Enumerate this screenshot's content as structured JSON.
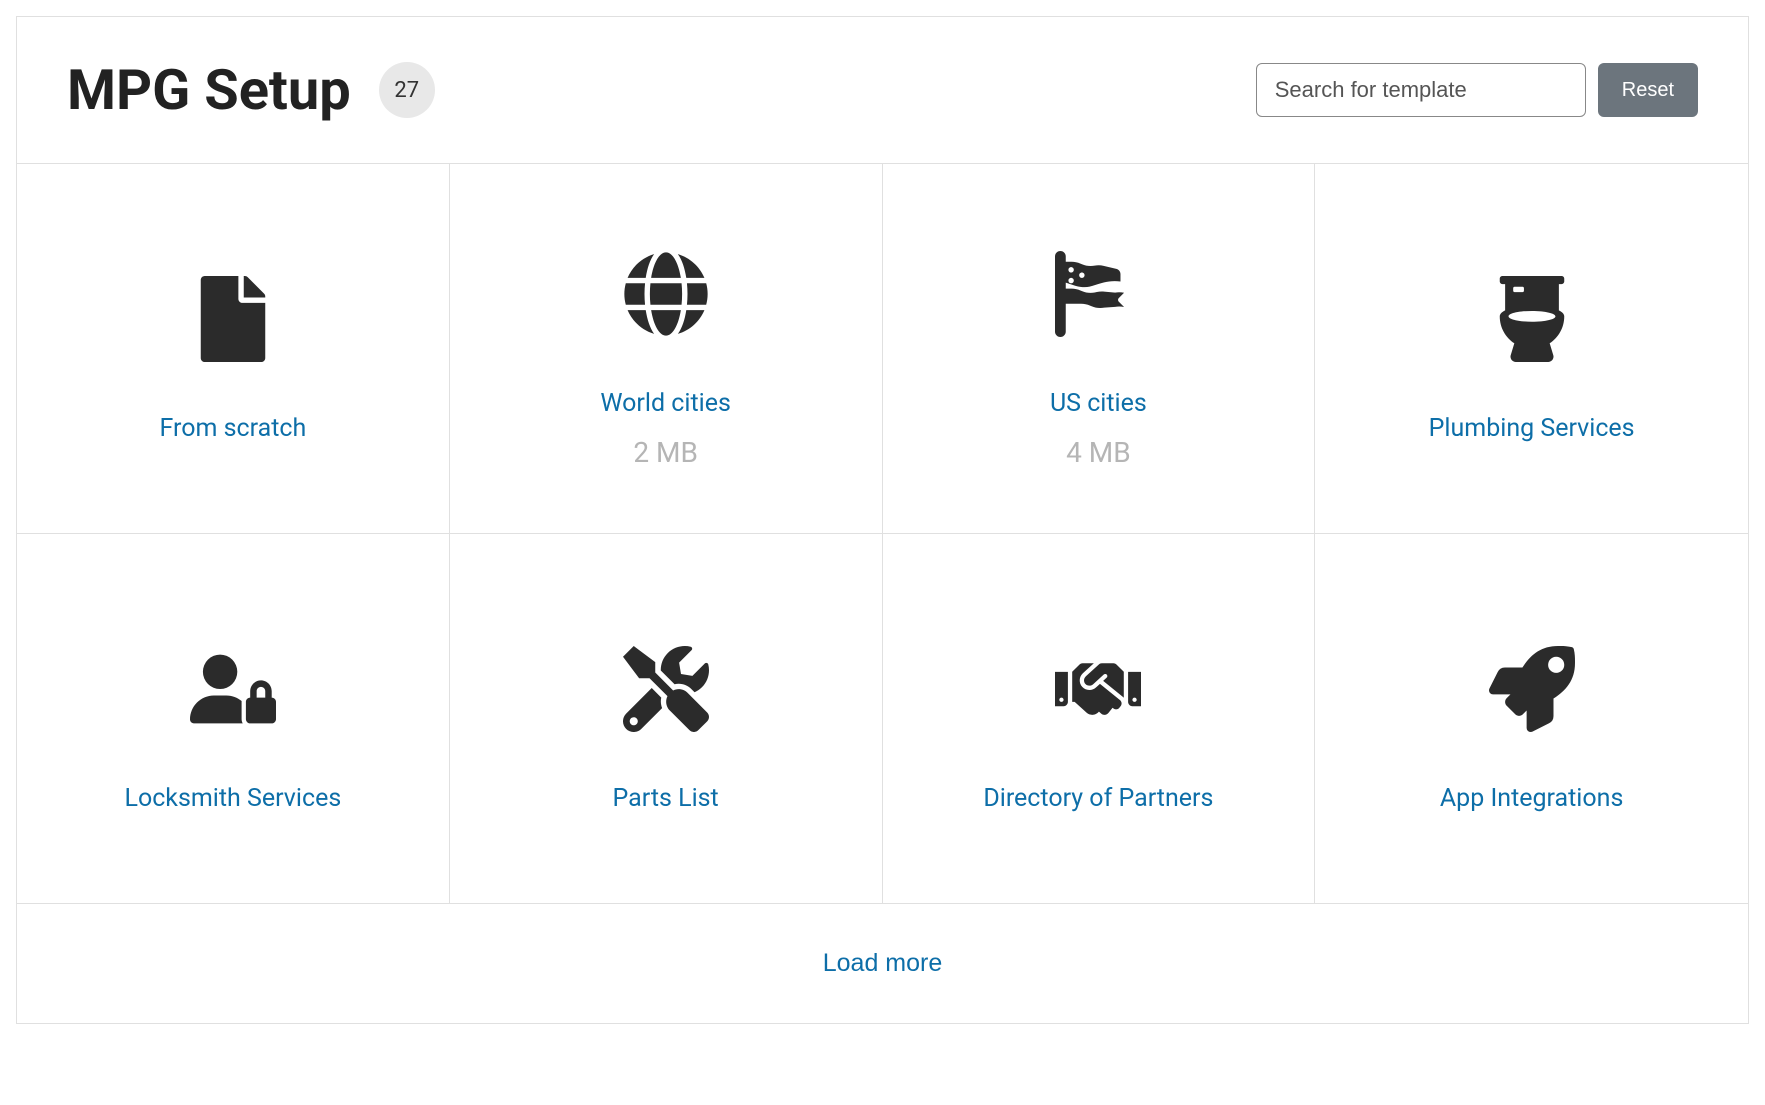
{
  "header": {
    "title": "MPG Setup",
    "count": "27",
    "search_placeholder": "Search for template",
    "reset_label": "Reset"
  },
  "cards": [
    {
      "title": "From scratch",
      "sub": "",
      "icon": "file"
    },
    {
      "title": "World cities",
      "sub": "2 MB",
      "icon": "globe"
    },
    {
      "title": "US cities",
      "sub": "4 MB",
      "icon": "flag-usa"
    },
    {
      "title": "Plumbing Services",
      "sub": "",
      "icon": "toilet"
    },
    {
      "title": "Locksmith Services",
      "sub": "",
      "icon": "user-lock"
    },
    {
      "title": "Parts List",
      "sub": "",
      "icon": "tools"
    },
    {
      "title": "Directory of Partners",
      "sub": "",
      "icon": "handshake"
    },
    {
      "title": "App Integrations",
      "sub": "",
      "icon": "rocket"
    }
  ],
  "footer": {
    "load_more": "Load more"
  }
}
